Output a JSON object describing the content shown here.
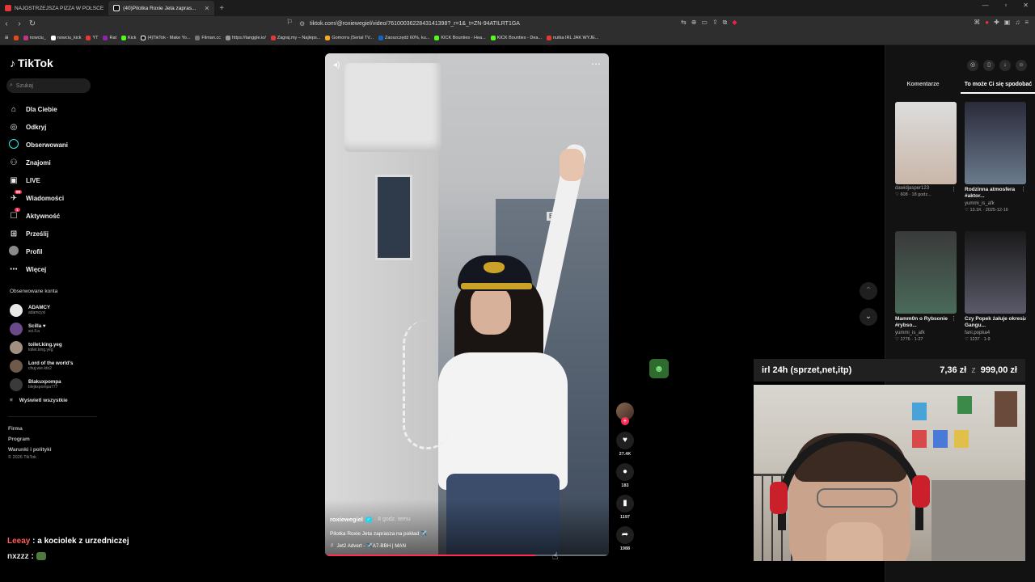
{
  "browser": {
    "tabs": [
      {
        "title": "NAJOSTRZEJSZA PIZZA W POLSCE",
        "color": "#e53935"
      },
      {
        "title": "(40)Pilotka Roxie Jeta zapras...",
        "color": "#ffffff"
      }
    ],
    "url": "tiktok.com/@roxiewegiel/video/7610003622843141398?_r=1&_t=ZN-94ATILRT1GA",
    "bookmarks": [
      "nowciu_",
      "nowciu_kick",
      "YT",
      "Rat",
      "Kick",
      "(4)TikTok - Make Yo...",
      "Filman.cc",
      "https://tanggle.io/",
      "Zagraj.my – Najleps...",
      "Gomorra (Serial TV...",
      "Zaoszczędź 60%, ku...",
      "KICK Bounties - Hea...",
      "KICK Bounties - Dea...",
      "nutka IRL JAK WYJE..."
    ]
  },
  "tiktok": {
    "logo": "TikTok",
    "search_placeholder": "Szukaj",
    "nav": [
      {
        "label": "Dla Ciebie",
        "icon": "home-icon"
      },
      {
        "label": "Odkryj",
        "icon": "compass-icon"
      },
      {
        "label": "Obserwowani",
        "icon": "following-icon"
      },
      {
        "label": "Znajomi",
        "icon": "friends-icon"
      },
      {
        "label": "LIVE",
        "icon": "live-icon"
      },
      {
        "label": "Wiadomości",
        "icon": "messages-icon",
        "badge": "99"
      },
      {
        "label": "Aktywność",
        "icon": "activity-icon",
        "badge": "1"
      },
      {
        "label": "Prześlij",
        "icon": "upload-icon"
      },
      {
        "label": "Profil",
        "icon": "profile-icon"
      },
      {
        "label": "Więcej",
        "icon": "more-icon"
      }
    ],
    "followed_title": "Obserwowane konta",
    "followed": [
      {
        "name": "ADAMCY",
        "handle": "adamcyxi",
        "color": "#e8e8e8"
      },
      {
        "name": "Scilla ♥",
        "handle": "sci.ll.a",
        "color": "#6a4a8a"
      },
      {
        "name": "toilet.king.yeg",
        "handle": "toilet.king.yeg",
        "color": "#a09080"
      },
      {
        "name": "Lord of the world's",
        "handle": "chuj.wie.kto2",
        "color": "#6d5a4a"
      },
      {
        "name": "Blakuxpompa",
        "handle": "blejkxpompa777",
        "color": "#3a3a3a"
      }
    ],
    "show_all": "Wyświetl wszystkie",
    "footer": [
      "Firma",
      "Program",
      "Warunki i polityki"
    ],
    "copyright": "© 2026 TikTok",
    "video": {
      "username": "roxiewegiel",
      "time": "· 8 godz. temu",
      "description": "Pilotka Roxie Jeta zaprasza na pokład ✈️",
      "music": "Jet2 Advert - ✈️A7-BBH | MAN ",
      "exit_sign": "EXIT",
      "progress": 0.74
    },
    "actions": {
      "likes": "27.4K",
      "comments": "183",
      "saves": "1197",
      "shares": "1988"
    },
    "right_tabs": [
      "Komentarze",
      "To może Ci się spodobać"
    ],
    "cards": [
      {
        "title": "",
        "user": "dawidjasper123",
        "meta": "♡ 608 · 18 godz...",
        "color": "#c9b6a8"
      },
      {
        "title": "Rodzinna atmosfera #aktor...",
        "user": "yummi_is_afk",
        "meta": "♡ 13.1K · 2025-12-16",
        "color": "#6a7b8c"
      },
      {
        "title": "Mamm0n o Rybsonie #rybso...",
        "user": "yummi_is_afk",
        "meta": "♡ 1776 · 1-27",
        "color": "#4a6a5a"
      },
      {
        "title": "Czy Popek żałuje okresu Gangu...",
        "user": "fani.popka4",
        "meta": "♡ 1237 · 1-9",
        "color": "#5a5a6a"
      }
    ]
  },
  "stream": {
    "donation_title": "irl 24h (sprzet,net,itp)",
    "donation_current": "7,36 zł",
    "donation_sep": "z",
    "donation_goal": "999,00 zł",
    "chat": [
      {
        "user": "Leeay",
        "message": "a kociolek z urzedniczej"
      },
      {
        "user": "nxzzz",
        "message": ""
      }
    ]
  }
}
